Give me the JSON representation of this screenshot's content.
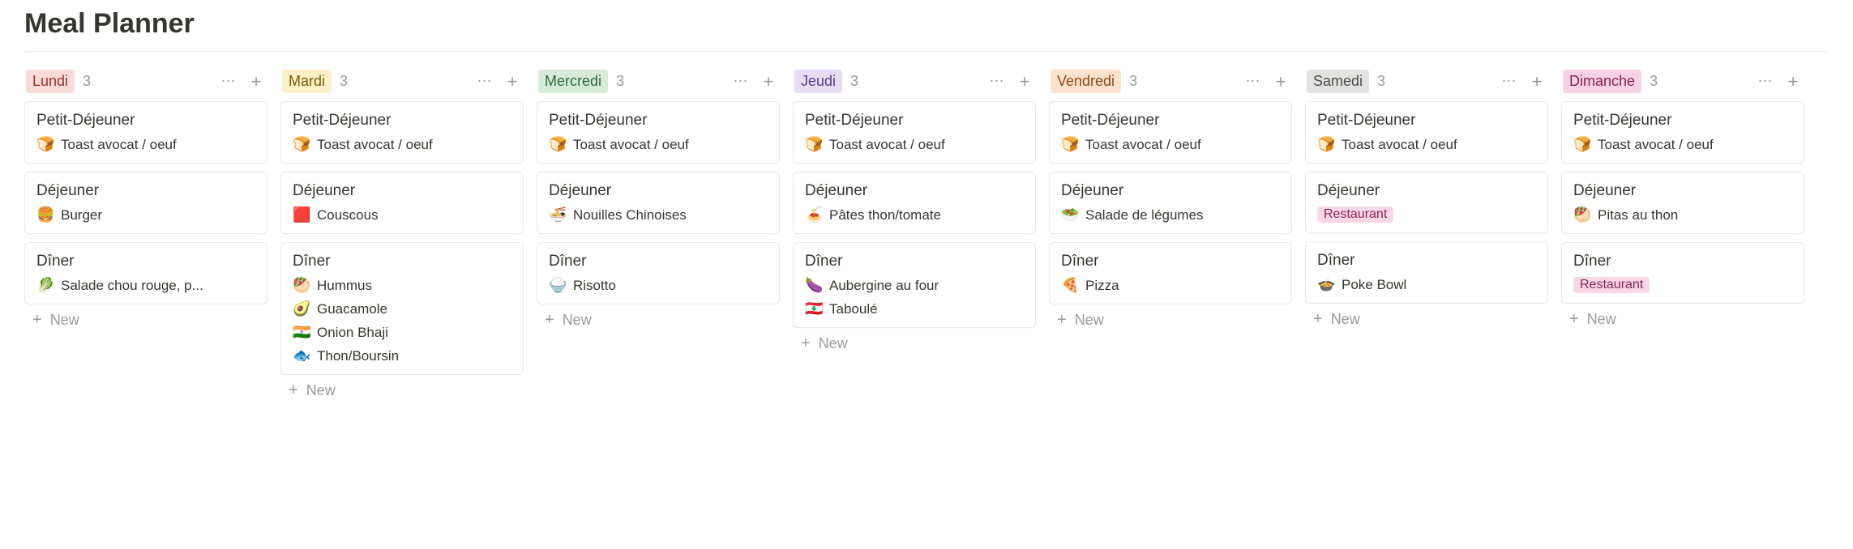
{
  "page_title": "Meal Planner",
  "new_label": "New",
  "columns": [
    {
      "name": "Lundi",
      "count": 3,
      "color_bg": "#fadbd8",
      "color_fg": "#9b2f2f",
      "cards": [
        {
          "title": "Petit-Déjeuner",
          "items": [
            {
              "emoji": "🍞",
              "label": "Toast avocat / oeuf"
            }
          ]
        },
        {
          "title": "Déjeuner",
          "items": [
            {
              "emoji": "🍔",
              "label": "Burger"
            }
          ]
        },
        {
          "title": "Dîner",
          "items": [
            {
              "emoji": "🥬",
              "label": "Salade chou rouge, p..."
            }
          ]
        }
      ]
    },
    {
      "name": "Mardi",
      "count": 3,
      "color_bg": "#fdf0c8",
      "color_fg": "#7a5b00",
      "cards": [
        {
          "title": "Petit-Déjeuner",
          "items": [
            {
              "emoji": "🍞",
              "label": "Toast avocat / oeuf"
            }
          ]
        },
        {
          "title": "Déjeuner",
          "items": [
            {
              "emoji": "🟥",
              "label": "Couscous"
            }
          ]
        },
        {
          "title": "Dîner",
          "items": [
            {
              "emoji": "🥙",
              "label": "Hummus"
            },
            {
              "emoji": "🥑",
              "label": "Guacamole"
            },
            {
              "emoji": "🇮🇳",
              "label": "Onion Bhaji"
            },
            {
              "emoji": "🐟",
              "label": "Thon/Boursin"
            }
          ]
        }
      ]
    },
    {
      "name": "Mercredi",
      "count": 3,
      "color_bg": "#d7ead9",
      "color_fg": "#2d6a3e",
      "cards": [
        {
          "title": "Petit-Déjeuner",
          "items": [
            {
              "emoji": "🍞",
              "label": "Toast avocat / oeuf"
            }
          ]
        },
        {
          "title": "Déjeuner",
          "items": [
            {
              "emoji": "🍜",
              "label": "Nouilles Chinoises"
            }
          ]
        },
        {
          "title": "Dîner",
          "items": [
            {
              "emoji": "🍚",
              "label": "Risotto"
            }
          ]
        }
      ]
    },
    {
      "name": "Jeudi",
      "count": 3,
      "color_bg": "#e6dcf3",
      "color_fg": "#5a3d8a",
      "cards": [
        {
          "title": "Petit-Déjeuner",
          "items": [
            {
              "emoji": "🍞",
              "label": "Toast avocat / oeuf"
            }
          ]
        },
        {
          "title": "Déjeuner",
          "items": [
            {
              "emoji": "🍝",
              "label": "Pâtes thon/tomate"
            }
          ]
        },
        {
          "title": "Dîner",
          "items": [
            {
              "emoji": "🍆",
              "label": "Aubergine au four"
            },
            {
              "emoji": "🇱🇧",
              "label": "Taboulé"
            }
          ]
        }
      ]
    },
    {
      "name": "Vendredi",
      "count": 3,
      "color_bg": "#fbe2cc",
      "color_fg": "#8a4b17",
      "cards": [
        {
          "title": "Petit-Déjeuner",
          "items": [
            {
              "emoji": "🍞",
              "label": "Toast avocat / oeuf"
            }
          ]
        },
        {
          "title": "Déjeuner",
          "items": [
            {
              "emoji": "🥗",
              "label": "Salade de légumes"
            }
          ]
        },
        {
          "title": "Dîner",
          "items": [
            {
              "emoji": "🍕",
              "label": "Pizza"
            }
          ]
        }
      ]
    },
    {
      "name": "Samedi",
      "count": 3,
      "color_bg": "#e3e2e0",
      "color_fg": "#4d4d4d",
      "cards": [
        {
          "title": "Petit-Déjeuner",
          "items": [
            {
              "emoji": "🍞",
              "label": "Toast avocat / oeuf"
            }
          ]
        },
        {
          "title": "Déjeuner",
          "items": [
            {
              "tag": "Restaurant"
            }
          ]
        },
        {
          "title": "Dîner",
          "items": [
            {
              "emoji": "🍲",
              "label": "Poke Bowl"
            }
          ]
        }
      ]
    },
    {
      "name": "Dimanche",
      "count": 3,
      "color_bg": "#f7d1e4",
      "color_fg": "#8a2255",
      "cards": [
        {
          "title": "Petit-Déjeuner",
          "items": [
            {
              "emoji": "🍞",
              "label": "Toast avocat / oeuf"
            }
          ]
        },
        {
          "title": "Déjeuner",
          "items": [
            {
              "emoji": "🥙",
              "label": "Pitas au thon"
            }
          ]
        },
        {
          "title": "Dîner",
          "items": [
            {
              "tag": "Restaurant"
            }
          ]
        }
      ]
    }
  ]
}
